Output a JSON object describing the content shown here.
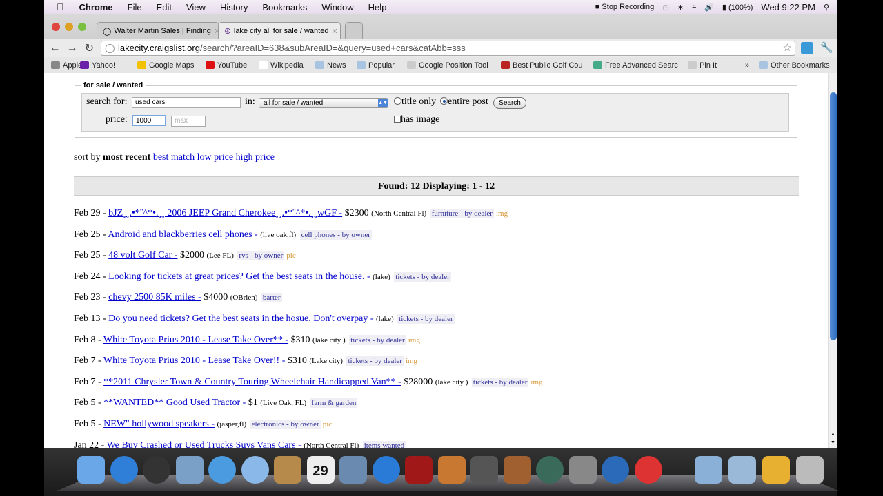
{
  "menubar": {
    "apple": "",
    "items": [
      "Chrome",
      "File",
      "Edit",
      "View",
      "History",
      "Bookmarks",
      "Window",
      "Help"
    ],
    "status": {
      "recording": "Stop Recording",
      "battery": "(100%)",
      "clock": "Wed 9:22 PM"
    }
  },
  "tabs": [
    {
      "label": "Walter Martin Sales | Finding",
      "active": false
    },
    {
      "label": "lake city all for sale / wanted",
      "active": true
    }
  ],
  "address": {
    "host": "lakecity.craigslist.org",
    "path": "/search/?areaID=638&subAreaID=&query=used+cars&catAbb=sss"
  },
  "bookmarks": [
    {
      "label": "Apple",
      "color": "#888"
    },
    {
      "label": "Yahoo!",
      "color": "#6b1fa8"
    },
    {
      "label": "Google Maps",
      "color": "#f2c200"
    },
    {
      "label": "YouTube",
      "color": "#d11"
    },
    {
      "label": "Wikipedia",
      "color": "#fff"
    },
    {
      "label": "News",
      "color": "#a8c4e0"
    },
    {
      "label": "Popular",
      "color": "#a8c4e0"
    },
    {
      "label": "Google Position Tool",
      "color": "#ccc"
    },
    {
      "label": "Best Public Golf Cou",
      "color": "#b22"
    },
    {
      "label": "Free Advanced Searc",
      "color": "#4a8"
    },
    {
      "label": "Pin It",
      "color": "#ccc"
    }
  ],
  "other_bookmarks": "Other Bookmarks",
  "more_bookmarks": "»",
  "search": {
    "legend": "for sale / wanted",
    "search_for_label": "search for:",
    "query": "used cars",
    "in_label": "in:",
    "category": "all for sale / wanted",
    "title_only": "title only",
    "entire_post": "entire post",
    "search_button": "Search",
    "price_label": "price:",
    "min_price": "1000",
    "max_placeholder": "max",
    "has_image": "has image",
    "selected_scope": "entire post",
    "has_image_checked": false
  },
  "sort": {
    "prefix": "sort by",
    "current": "most recent",
    "options": [
      "best match",
      "low price",
      "high price"
    ]
  },
  "found": "Found: 12 Displaying: 1 - 12",
  "listings": [
    {
      "date": "Feb 29 -",
      "title": "bJZ¸¸.•*¨^*•.¸¸ 2006 JEEP Grand Cherokee¸¸.•*¨^*•.¸¸wGF -",
      "price": "$2300",
      "loc": "(North Central Fl)",
      "cat": "furniture - by dealer",
      "tag": "img"
    },
    {
      "date": "Feb 25 -",
      "title": "Android and blackberries cell phones -",
      "price": "",
      "loc": "(live oak,fl)",
      "cat": "cell phones - by owner",
      "tag": ""
    },
    {
      "date": "Feb 25 -",
      "title": "48 volt Golf Car -",
      "price": "$2000",
      "loc": "(Lee FL)",
      "cat": "rvs - by owner",
      "tag": "pic"
    },
    {
      "date": "Feb 24 -",
      "title": "Looking for tickets at great prices? Get the best seats in the house. -",
      "price": "",
      "loc": "(lake)",
      "cat": "tickets - by dealer",
      "tag": ""
    },
    {
      "date": "Feb 23 -",
      "title": "chevy 2500 85K miles -",
      "price": "$4000",
      "loc": "(OBrien)",
      "cat": "barter",
      "tag": ""
    },
    {
      "date": "Feb 13 -",
      "title": "Do you need tickets? Get the best seats in the hosue. Don't overpay -",
      "price": "",
      "loc": "(lake)",
      "cat": "tickets - by dealer",
      "tag": ""
    },
    {
      "date": "Feb 8 -",
      "title": "White Toyota Prius 2010 - Lease Take Over** -",
      "price": "$310",
      "loc": "(lake city )",
      "cat": "tickets - by dealer",
      "tag": "img"
    },
    {
      "date": "Feb 7 -",
      "title": "White Toyota Prius 2010 - Lease Take Over!! -",
      "price": "$310",
      "loc": "(Lake city)",
      "cat": "tickets - by dealer",
      "tag": "img"
    },
    {
      "date": "Feb 7 -",
      "title": "**2011 Chrysler Town & Country Touring Wheelchair Handicapped Van** -",
      "price": "$28000",
      "loc": "(lake city )",
      "cat": "tickets - by dealer",
      "tag": "img"
    },
    {
      "date": "Feb 5 -",
      "title": "**WANTED** Good Used Tractor -",
      "price": "$1",
      "loc": "(Live Oak, FL)",
      "cat": "farm & garden",
      "tag": ""
    },
    {
      "date": "Feb 5 -",
      "title": "NEW\" hollywood speakers -",
      "price": "",
      "loc": "(jasper,fl)",
      "cat": "electronics - by owner",
      "tag": "pic"
    },
    {
      "date": "Jan 22 -",
      "title": "We Buy Crashed or Used Trucks Suvs Vans Cars -",
      "price": "",
      "loc": "(North Central Fl)",
      "cat": "items wanted",
      "tag": ""
    }
  ],
  "dock": {
    "calendar_day": "29",
    "apps": [
      {
        "name": "finder",
        "color": "#6aa7e8"
      },
      {
        "name": "app-store",
        "color": "#2f7fd8"
      },
      {
        "name": "dashboard",
        "color": "#333"
      },
      {
        "name": "mail",
        "color": "#7aa0c8"
      },
      {
        "name": "safari",
        "color": "#4a9be0"
      },
      {
        "name": "facetime",
        "color": "#8ab8e8"
      },
      {
        "name": "address-book",
        "color": "#b58a4a"
      },
      {
        "name": "ical",
        "color": "#eee"
      },
      {
        "name": "iphoto",
        "color": "#6a8ab0"
      },
      {
        "name": "itunes",
        "color": "#2a7ad8"
      },
      {
        "name": "photo-booth",
        "color": "#a01818"
      },
      {
        "name": "image-capture",
        "color": "#c87830"
      },
      {
        "name": "imovie",
        "color": "#555"
      },
      {
        "name": "garageband",
        "color": "#a06030"
      },
      {
        "name": "time-machine",
        "color": "#3a6a5a"
      },
      {
        "name": "system-preferences",
        "color": "#888"
      },
      {
        "name": "quicktime",
        "color": "#2a6ab8"
      },
      {
        "name": "chrome",
        "color": "#d33"
      },
      {
        "name": "applications-folder",
        "color": "#8ab0d8"
      },
      {
        "name": "documents-folder",
        "color": "#9ab8d8"
      },
      {
        "name": "stack",
        "color": "#e8b030"
      },
      {
        "name": "trash",
        "color": "#bbb"
      }
    ]
  }
}
